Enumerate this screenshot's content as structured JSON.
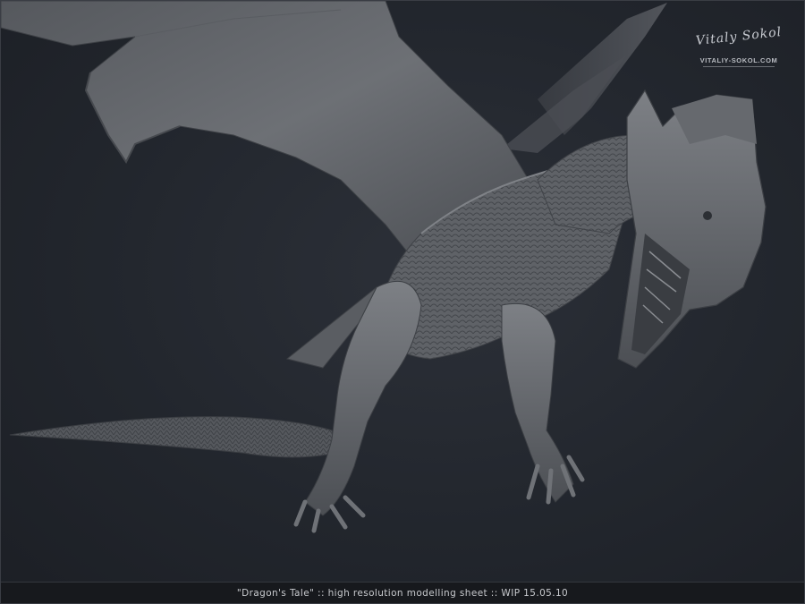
{
  "watermark": {
    "signature": "Vitaly Sokol",
    "site": "VITALIY-SOKOL.COM"
  },
  "caption": "\"Dragon's Tale\" :: high resolution modelling sheet :: WIP 15.05.10",
  "colors": {
    "background": "#22262d",
    "caption_bar": "#17191d",
    "sculpt": "#6e7074"
  }
}
